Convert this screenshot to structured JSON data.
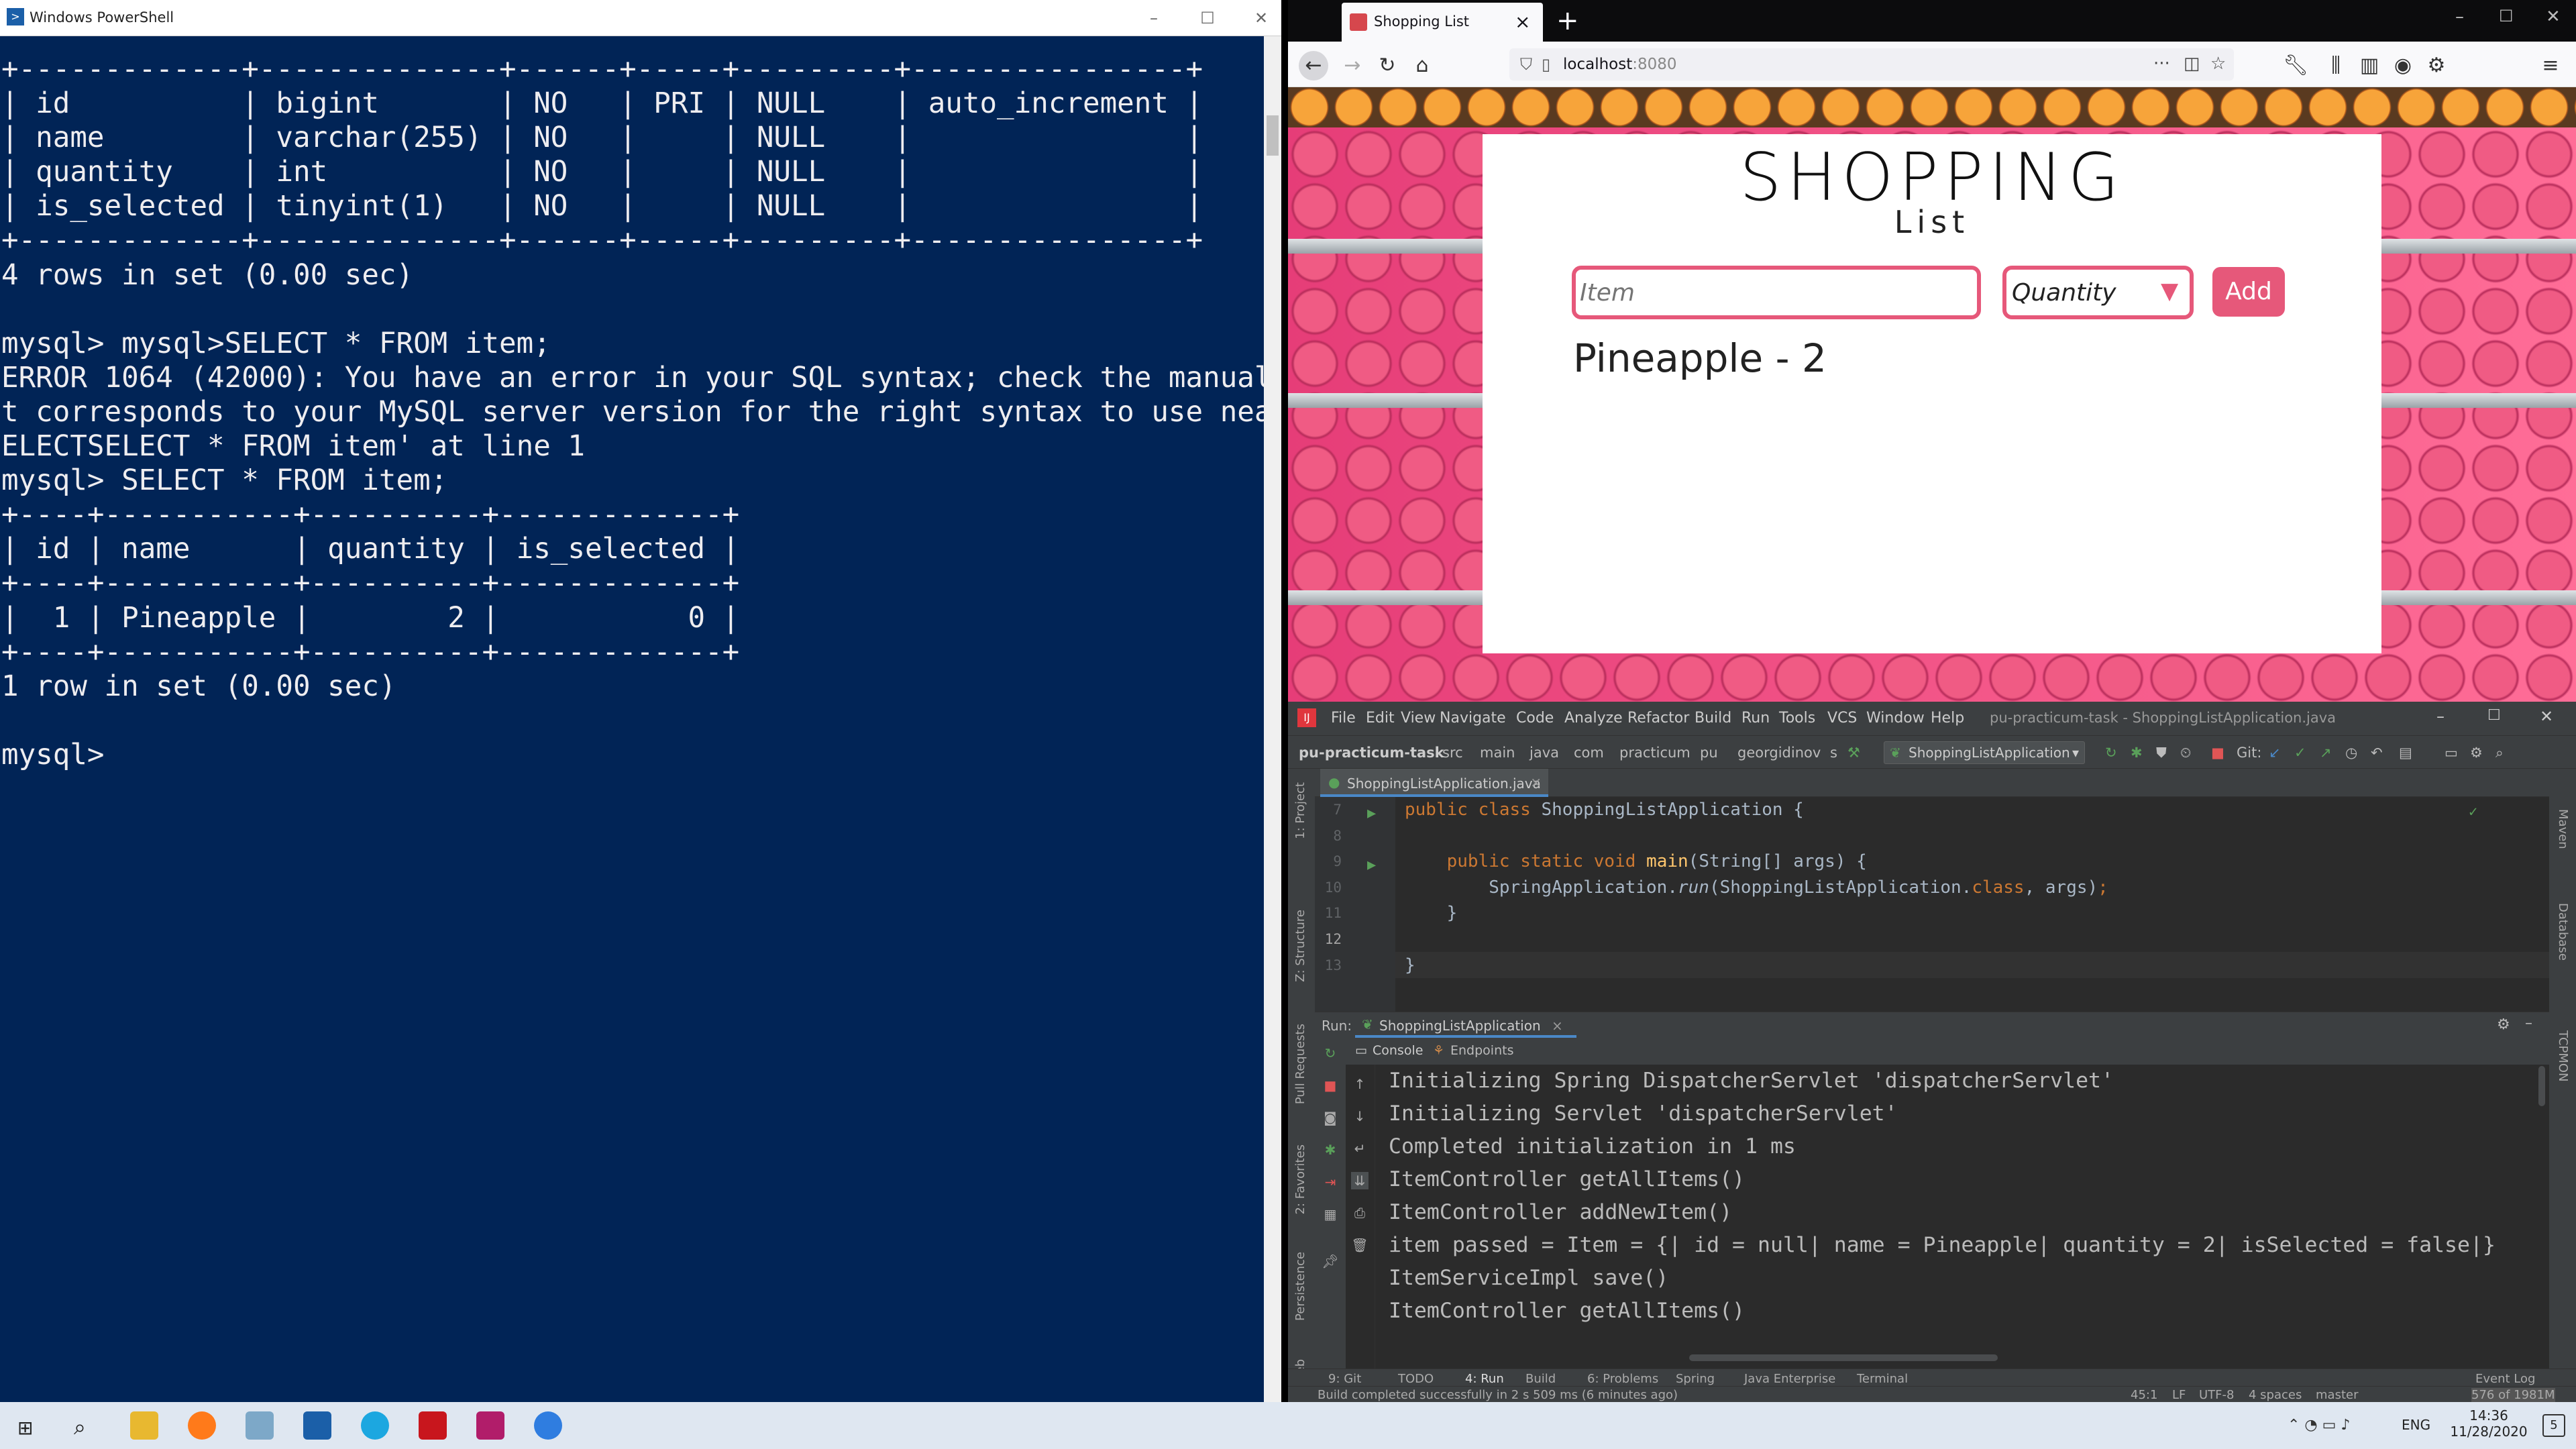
{
  "powershell": {
    "title": "Windows PowerShell",
    "lines": [
      "+-------------+--------------+------+-----+---------+----------------+",
      "| id          | bigint       | NO   | PRI | NULL    | auto_increment |",
      "| name        | varchar(255) | NO   |     | NULL    |                |",
      "| quantity    | int          | NO   |     | NULL    |                |",
      "| is_selected | tinyint(1)   | NO   |     | NULL    |                |",
      "+-------------+--------------+------+-----+---------+----------------+",
      "4 rows in set (0.00 sec)",
      "",
      "mysql> mysql>SELECT * FROM item;",
      "ERROR 1064 (42000): You have an error in your SQL syntax; check the manual tha",
      "t corresponds to your MySQL server version for the right syntax to use near 'S",
      "ELECTSELECT * FROM item' at line 1",
      "mysql> SELECT * FROM item;",
      "+----+-----------+----------+-------------+",
      "| id | name      | quantity | is_selected |",
      "+----+-----------+----------+-------------+",
      "|  1 | Pineapple |        2 |           0 |",
      "+----+-----------+----------+-------------+",
      "1 row in set (0.00 sec)",
      "",
      "mysql>"
    ]
  },
  "firefox": {
    "tab_title": "Shopping List",
    "url_host": "localhost",
    "url_port": ":8080",
    "app": {
      "title": "SHOPPING",
      "subtitle": "List",
      "item_placeholder": "Item",
      "quantity_label": "Quantity",
      "add_label": "Add",
      "items": [
        "Pineapple - 2"
      ]
    }
  },
  "intellij": {
    "menu": [
      "File",
      "Edit",
      "View",
      "Navigate",
      "Code",
      "Analyze",
      "Refactor",
      "Build",
      "Run",
      "Tools",
      "VCS",
      "Window",
      "Help"
    ],
    "window_title": "pu-practicum-task - ShoppingListApplication.java",
    "breadcrumbs": [
      "pu-practicum-task",
      "src",
      "main",
      "java",
      "com",
      "practicum",
      "pu",
      "georgidinov",
      "s"
    ],
    "run_config": "ShoppingListApplication",
    "git_label": "Git:",
    "editor_tab": "ShoppingListApplication.java",
    "line_numbers": [
      "7",
      "8",
      "9",
      "10",
      "11",
      "12",
      "13"
    ],
    "run_label": "Run:",
    "run_tab": "ShoppingListApplication",
    "console_tab": "Console",
    "endpoints_tab": "Endpoints",
    "console": [
      "Initializing Spring DispatcherServlet 'dispatcherServlet'",
      "Initializing Servlet 'dispatcherServlet'",
      "Completed initialization in 1 ms",
      "ItemController getAllItems()",
      "ItemController addNewItem()",
      "item passed = Item = {| id = null| name = Pineapple| quantity = 2| isSelected = false|}",
      "ItemServiceImpl save()",
      "ItemController getAllItems()"
    ],
    "bottom_tabs": [
      "9: Git",
      "TODO",
      "4: Run",
      "Build",
      "6: Problems",
      "Spring",
      "Java Enterprise",
      "Terminal"
    ],
    "event_log": "Event Log",
    "left_tools": [
      "1: Project",
      "Z: Structure",
      "Pull Requests",
      "2: Favorites",
      "Persistence",
      "Web"
    ],
    "right_tools": [
      "Maven",
      "Database",
      "TCPMON"
    ],
    "status_msg": "Build completed successfully in 2 s 509 ms (6 minutes ago)",
    "status_pos": "45:1",
    "status_le": "LF",
    "status_enc": "UTF-8",
    "status_indent": "4 spaces",
    "status_branch": "master",
    "status_mem": "576 of 1981M"
  },
  "taskbar": {
    "lang": "ENG",
    "time": "14:36",
    "date": "11/28/2020",
    "notif_count": "5"
  }
}
